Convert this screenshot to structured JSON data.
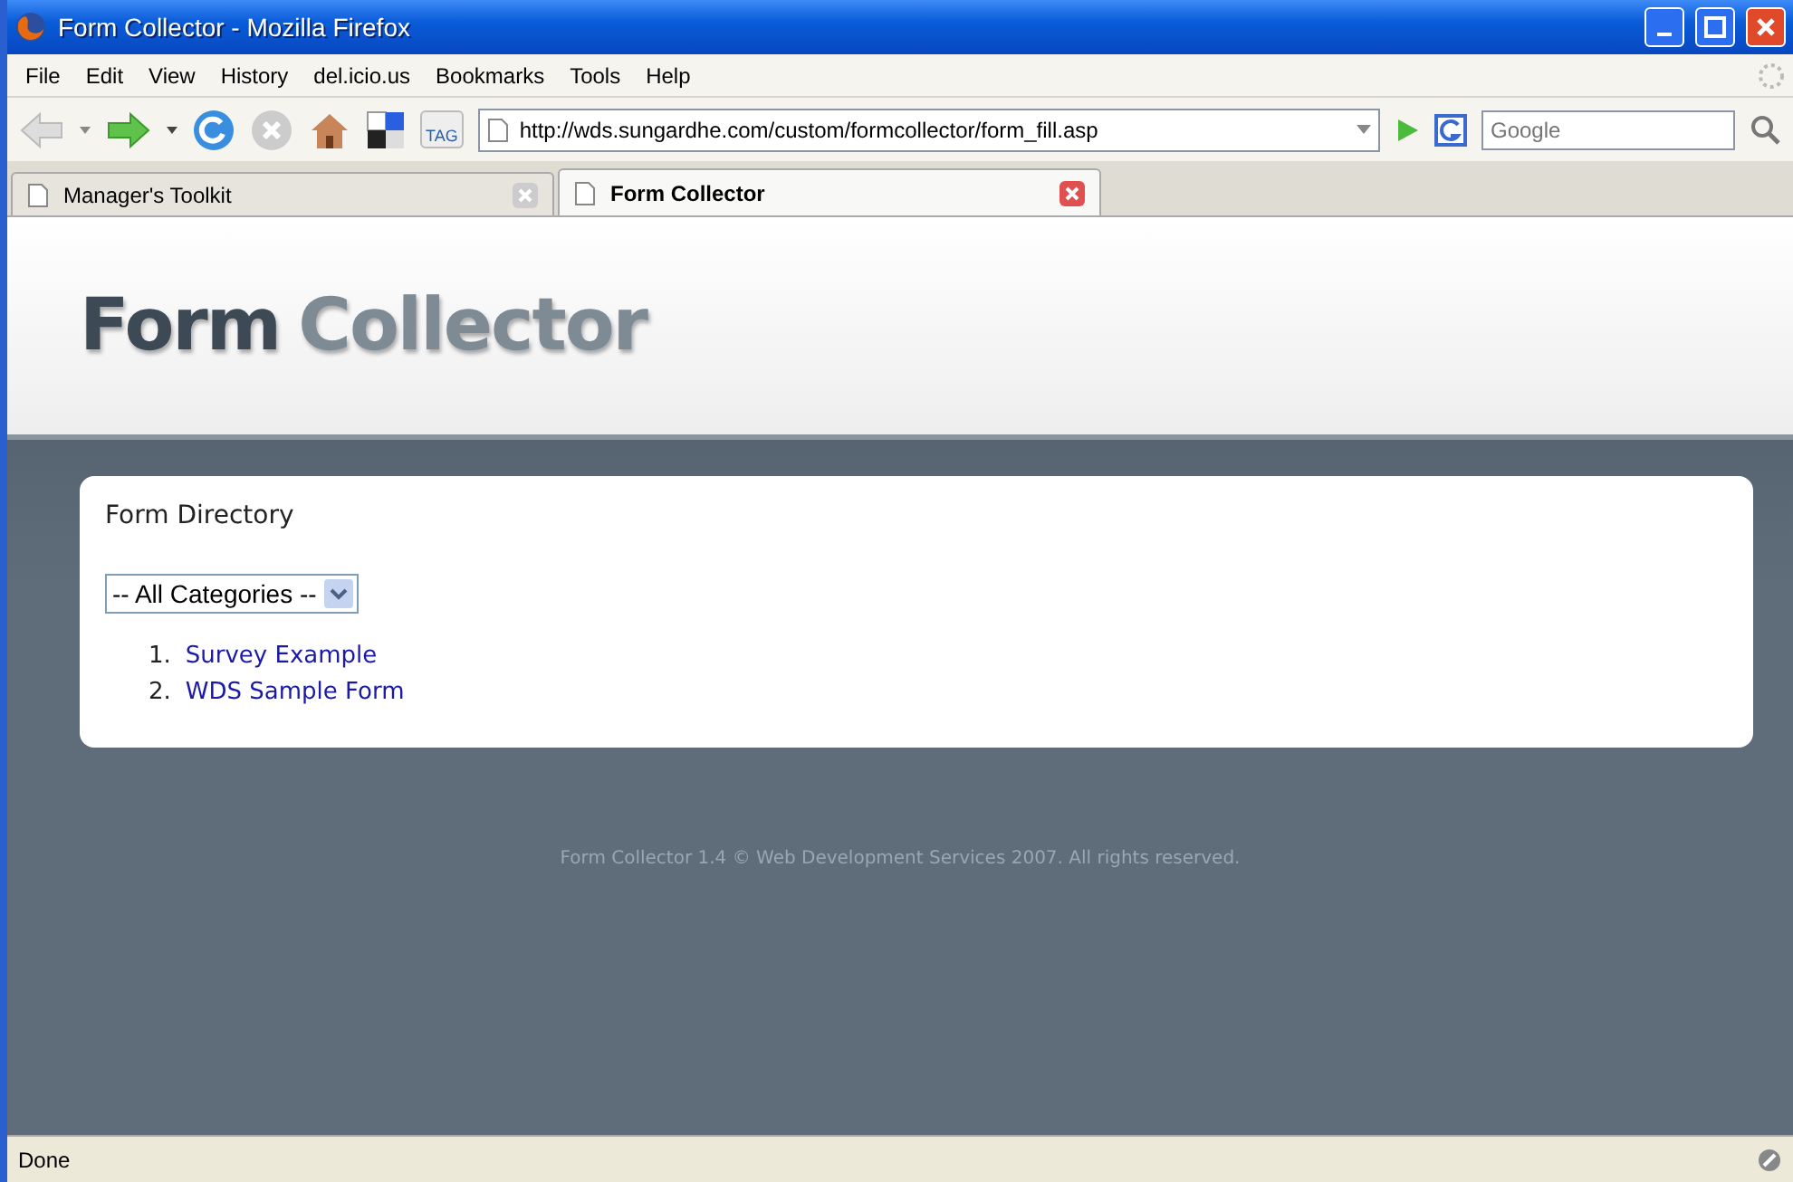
{
  "window": {
    "title": "Form Collector - Mozilla Firefox"
  },
  "menu": [
    "File",
    "Edit",
    "View",
    "History",
    "del.icio.us",
    "Bookmarks",
    "Tools",
    "Help"
  ],
  "address": {
    "value": "http://wds.sungardhe.com/custom/formcollector/form_fill.asp"
  },
  "search": {
    "placeholder": "Google"
  },
  "tag_label": "TAG",
  "tabs": [
    {
      "label": "Manager's Toolkit",
      "selected": false
    },
    {
      "label": "Form Collector",
      "selected": true
    }
  ],
  "logo": {
    "primary": "Form",
    "secondary": "Collector"
  },
  "directory": {
    "title": "Form Directory",
    "category": "-- All Categories --",
    "forms": [
      {
        "number": "1.",
        "name": "Survey Example"
      },
      {
        "number": "2.",
        "name": "WDS Sample Form"
      }
    ]
  },
  "footer": "Form Collector 1.4 © Web Development Services 2007. All rights reserved.",
  "status_bar": {
    "text": "Done"
  }
}
